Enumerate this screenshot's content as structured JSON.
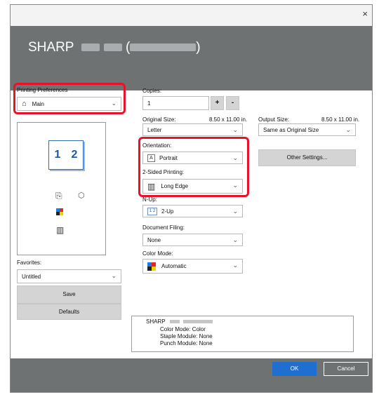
{
  "window": {
    "close_glyph": "×"
  },
  "brand": {
    "name": "SHARP",
    "paren_open": "(",
    "paren_close": ")"
  },
  "left": {
    "printing_prefs_label": "Printing Preferences",
    "printing_prefs_value": "Main",
    "favorites_label": "Favorites:",
    "favorites_value": "Untitled",
    "save_label": "Save",
    "defaults_label": "Defaults",
    "preview_pages": [
      "1",
      "2"
    ]
  },
  "copies": {
    "label": "Copies:",
    "value": "1",
    "plus": "+",
    "minus": "-"
  },
  "original_size": {
    "label": "Original Size:",
    "dims": "8.50 x 11.00 in.",
    "value": "Letter"
  },
  "output_size": {
    "label": "Output Size:",
    "dims": "8.50 x 11.00 in.",
    "value": "Same as Original Size"
  },
  "orientation": {
    "label": "Orientation:",
    "value": "Portrait",
    "icon_glyph": "A"
  },
  "two_sided": {
    "label": "2-Sided Printing:",
    "value": "Long Edge"
  },
  "nup": {
    "label": "N-Up:",
    "value": "2-Up",
    "icon_glyph": "1 2"
  },
  "doc_filing": {
    "label": "Document Filing:",
    "value": "None"
  },
  "color_mode": {
    "label": "Color Mode:",
    "value": "Automatic"
  },
  "other_settings": {
    "label": "Other Settings..."
  },
  "summary": {
    "title": "SHARP",
    "lines": [
      "Color Mode: Color",
      "Staple Module: None",
      "Punch Module: None"
    ]
  },
  "footer": {
    "ok": "OK",
    "cancel": "Cancel"
  },
  "colors": {
    "highlight": "#e8132a",
    "banner": "#6f7273",
    "ok_button": "#1f6fd1",
    "page_digits": "#1b58a8"
  }
}
